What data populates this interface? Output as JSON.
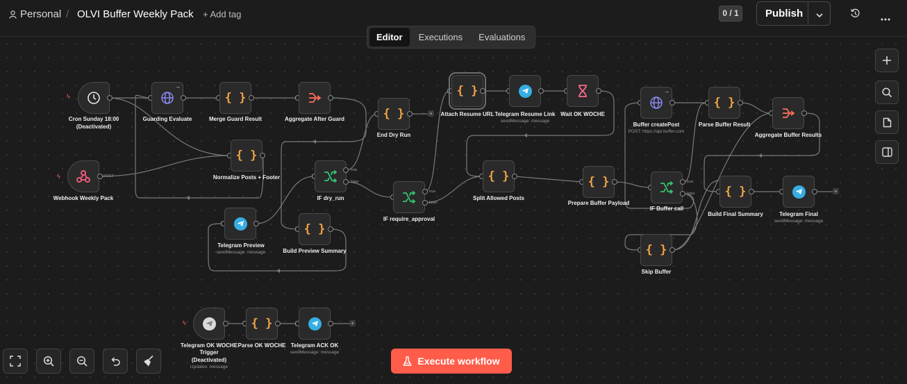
{
  "header": {
    "breadcrumb_parent": "Personal",
    "separator": "/",
    "workflow_name": "OLVI Buffer Weekly Pack",
    "add_tag": "+ Add tag",
    "counter": "0 / 1",
    "publish": "Publish"
  },
  "tabs": [
    "Editor",
    "Executions",
    "Evaluations"
  ],
  "nodes": {
    "cron": {
      "label": "Cron Sunday 18:00",
      "status": "(Deactivated)"
    },
    "webhook": {
      "label": "Webhook Weekly Pack",
      "port": "POST"
    },
    "guarding": {
      "label": "Guarding Evaluate"
    },
    "merge_guard": {
      "label": "Merge Guard Result"
    },
    "aggregate_after_guard": {
      "label": "Aggregate After Guard"
    },
    "normalize": {
      "label": "Normalize Posts + Footer"
    },
    "telegram_preview": {
      "label": "Telegram Preview",
      "sub": "sendMessage: message"
    },
    "build_preview": {
      "label": "Build Preview Summary"
    },
    "if_dry_run": {
      "label": "IF dry_run"
    },
    "end_dry_run": {
      "label": "End Dry Run"
    },
    "if_require_approval": {
      "label": "IF require_approval"
    },
    "attach_resume": {
      "label": "Attach Resume URL"
    },
    "telegram_resume": {
      "label": "Telegram Resume Link",
      "sub": "sendMessage: message"
    },
    "wait_ok": {
      "label": "Wait OK WOCHE"
    },
    "split_allowed": {
      "label": "Split Allowed Posts"
    },
    "prepare_buffer": {
      "label": "Prepare Buffer Payload"
    },
    "buffer_create": {
      "label": "Buffer createPost",
      "sub": "POST: https://api.buffer.com"
    },
    "parse_buffer": {
      "label": "Parse Buffer Result"
    },
    "aggregate_buffer": {
      "label": "Aggregate Buffer Results"
    },
    "if_buffer_call": {
      "label": "IF Buffer call"
    },
    "skip_buffer": {
      "label": "Skip Buffer"
    },
    "build_final": {
      "label": "Build Final Summary"
    },
    "telegram_final": {
      "label": "Telegram Final",
      "sub": "sendMessage: message"
    },
    "tg_trigger": {
      "label": "Telegram OK WOCHE",
      "label2": "Trigger",
      "status": "(Deactivated)",
      "sub": "Updates: message"
    },
    "parse_ok": {
      "label": "Parse OK WOCHE"
    },
    "telegram_ack": {
      "label": "Telegram ACK OK",
      "sub": "sendMessage: message"
    }
  },
  "ports": {
    "true": "true",
    "false": "false"
  },
  "execute": {
    "label": "Execute workflow",
    "color": "#ff5c4a"
  },
  "colors": {
    "accent": "#ff6d5a",
    "telegram": "#37aee2",
    "code": "#f0a347",
    "if": "#35c46f",
    "http": "#8b8bf5"
  }
}
